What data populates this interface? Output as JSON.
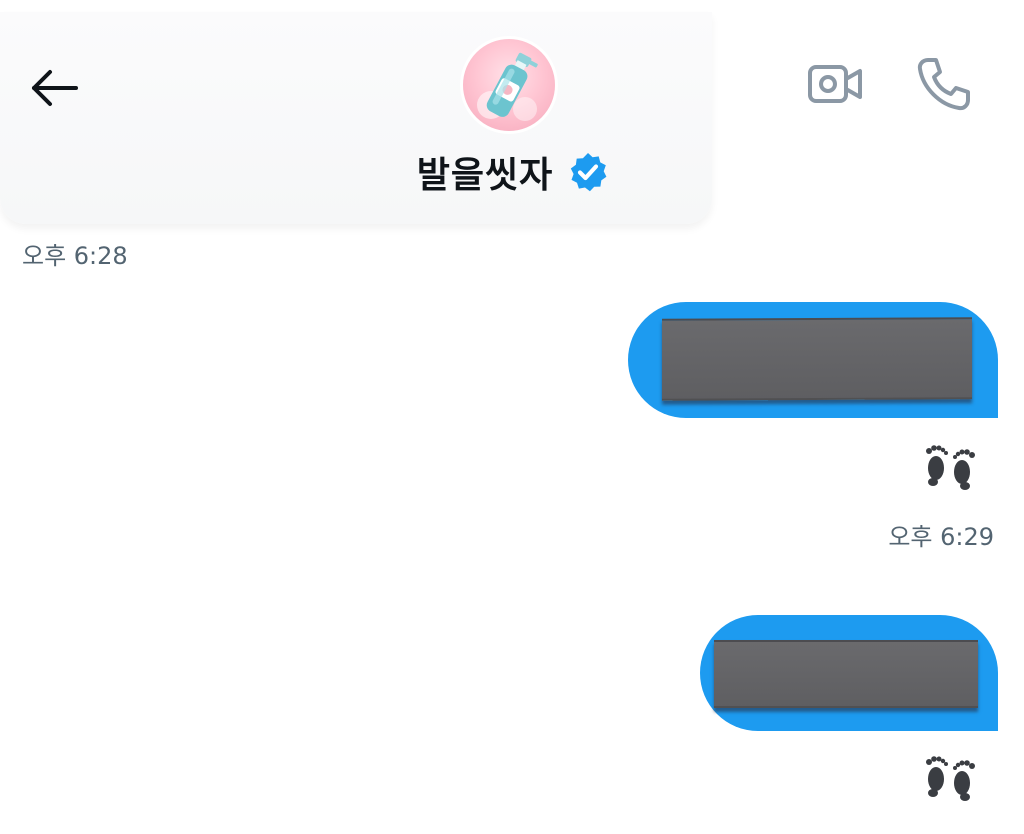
{
  "header": {
    "contact_name": "발을씻자",
    "verified": true,
    "accent_color": "#1d9bf0",
    "icons": {
      "back": "arrow-left-icon",
      "video": "video-camera-icon",
      "call": "phone-icon",
      "verified": "verified-badge-icon"
    }
  },
  "messages": [
    {
      "kind": "timestamp",
      "text": "오후 6:28",
      "align": "left"
    },
    {
      "kind": "sent-message",
      "content": "redacted",
      "bubble_color": "#1d9bf0",
      "reaction": "footprints-emoji"
    },
    {
      "kind": "timestamp",
      "text": "오후 6:29",
      "align": "right"
    },
    {
      "kind": "sent-message",
      "content": "redacted",
      "bubble_color": "#1d9bf0",
      "reaction": "footprints-emoji"
    }
  ]
}
